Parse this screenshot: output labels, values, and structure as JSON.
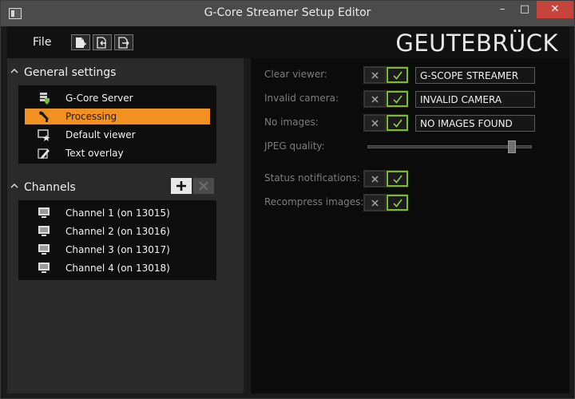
{
  "window": {
    "title": "G-Core Streamer Setup Editor",
    "controls": {
      "minimize": "–",
      "maximize": "□",
      "close": "✕"
    }
  },
  "menubar": {
    "file_label": "File",
    "toolbar_icons": [
      "new-file-icon",
      "import-icon",
      "export-icon"
    ],
    "brand": "GEUTEBRÜCK"
  },
  "general_settings": {
    "header": "General settings",
    "items": [
      {
        "label": "G-Core Server",
        "icon": "server-shield-icon"
      },
      {
        "label": "Processing",
        "icon": "wrench-icon",
        "selected": true
      },
      {
        "label": "Default viewer",
        "icon": "viewer-star-icon"
      },
      {
        "label": "Text overlay",
        "icon": "pencil-icon"
      }
    ]
  },
  "channels": {
    "header": "Channels",
    "items": [
      {
        "label": "Channel 1 (on 13015)",
        "icon": "monitor-icon"
      },
      {
        "label": "Channel 2 (on 13016)",
        "icon": "monitor-icon"
      },
      {
        "label": "Channel 3 (on 13017)",
        "icon": "monitor-icon"
      },
      {
        "label": "Channel 4 (on 13018)",
        "icon": "monitor-icon"
      }
    ]
  },
  "processing": {
    "clear_viewer": {
      "label": "Clear viewer:",
      "enabled": true,
      "value": "G-SCOPE STREAMER"
    },
    "invalid_camera": {
      "label": "Invalid camera:",
      "enabled": true,
      "value": "INVALID CAMERA"
    },
    "no_images": {
      "label": "No images:",
      "enabled": true,
      "value": "NO IMAGES FOUND"
    },
    "jpeg_quality": {
      "label": "JPEG quality:",
      "value_fraction": 0.9
    },
    "status_notifications": {
      "label": "Status notifications:",
      "enabled": true
    },
    "recompress_images": {
      "label": "Recompress images:",
      "enabled": true
    }
  },
  "colors": {
    "accent": "#f29021",
    "check": "#7cbc2e",
    "close_button": "#c7443a"
  }
}
